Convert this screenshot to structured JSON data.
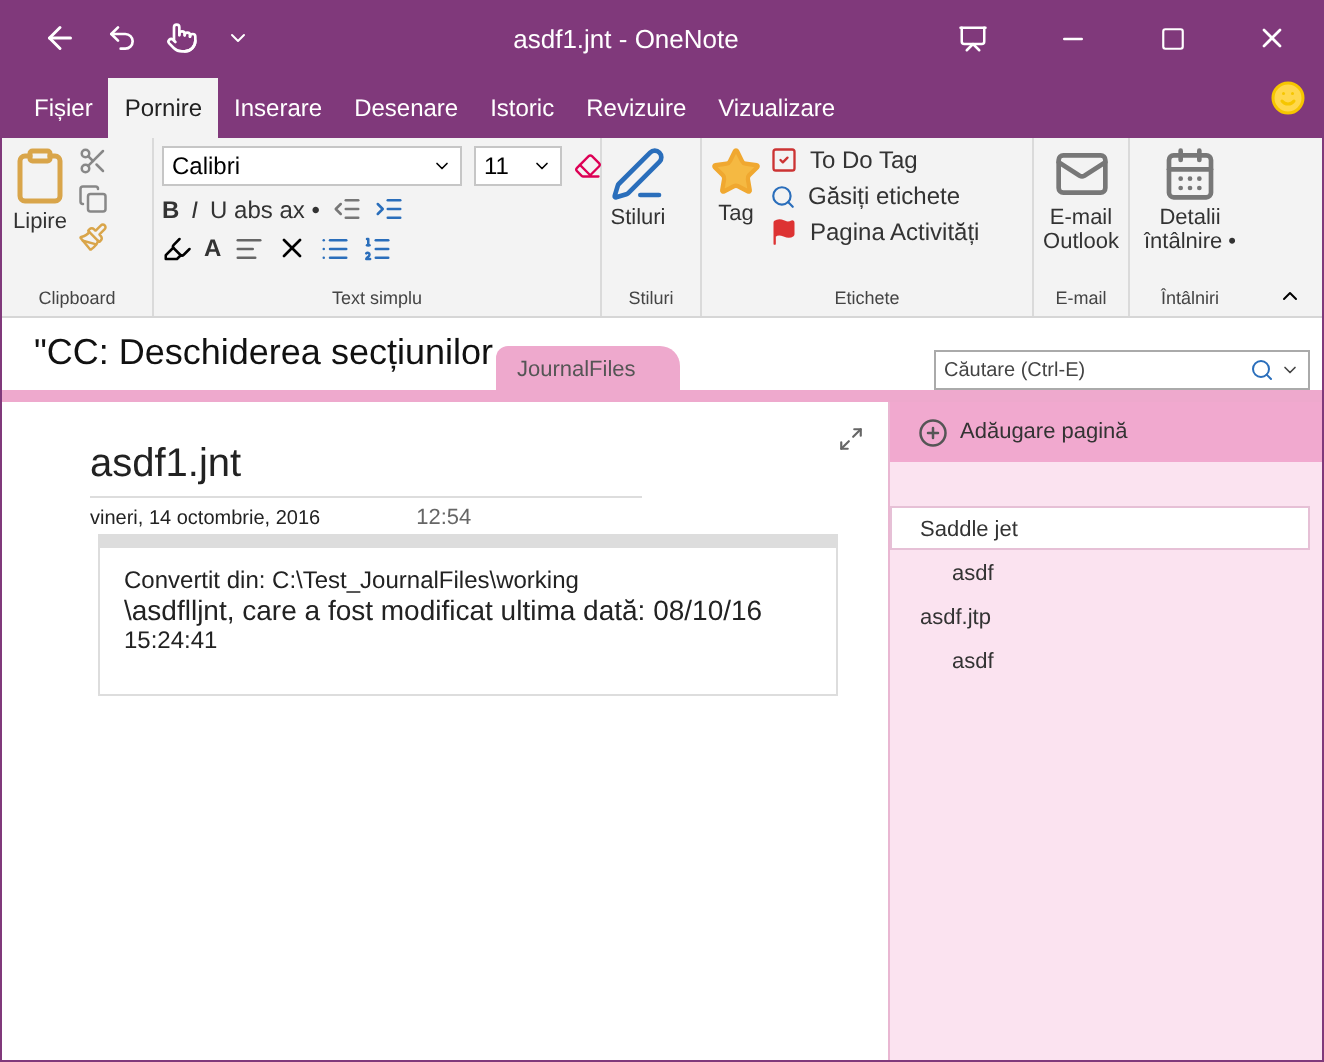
{
  "window": {
    "title": "asdf1.jnt  -  OneNote"
  },
  "ribbon_tabs": [
    {
      "label": "Fișier",
      "selected": false
    },
    {
      "label": "Pornire",
      "selected": true
    },
    {
      "label": "Inserare",
      "selected": false
    },
    {
      "label": "Desenare",
      "selected": false
    },
    {
      "label": "Istoric",
      "selected": false
    },
    {
      "label": "Revizuire",
      "selected": false
    },
    {
      "label": "Vizualizare",
      "selected": false
    }
  ],
  "ribbon": {
    "clipboard": {
      "paste": "Lipire",
      "label": "Clipboard"
    },
    "text": {
      "font": "Calibri",
      "size": "11",
      "bold": "B",
      "italic": "I",
      "effects": "U abs ax •",
      "font_color": "A",
      "label": "Text simplu"
    },
    "styles": {
      "button": "Stiluri",
      "label": "Stiluri"
    },
    "tags": {
      "button": "Tag",
      "todo": "To Do Tag",
      "find": "Găsiți etichete",
      "outlook_tasks": "Pagina Activități",
      "label": "Etichete"
    },
    "email": {
      "button": "E-mail Outlook",
      "label": "E-mail"
    },
    "meetings": {
      "button": "Detalii întâlnire •",
      "label": "Întâlniri"
    }
  },
  "notebook": {
    "title": "\"CC: Deschiderea secțiunilor",
    "section_tab": "JournalFiles",
    "search": {
      "placeholder": "Căutare (Ctrl-E)"
    }
  },
  "page": {
    "title": "asdf1.jnt",
    "date": "vineri, 14 octombrie, 2016",
    "time": "12:54",
    "note_lines": [
      {
        "text": "Convertit din: C:\\Test_JournalFiles\\working",
        "kind": "small"
      },
      {
        "text": "\\asdflljnt, care a fost modificat ultima dată: 08/10/16",
        "kind": "large"
      },
      {
        "text": "15:24:41",
        "kind": "small"
      }
    ]
  },
  "pages_panel": {
    "add_page": "Adăugare pagină",
    "pages": [
      {
        "label": "Saddle jet",
        "selected": true,
        "children": [
          {
            "label": "asdf",
            "selected": false
          }
        ]
      },
      {
        "label": "asdf.jtp",
        "selected": false,
        "children": [
          {
            "label": "asdf",
            "selected": false
          }
        ]
      }
    ]
  }
}
